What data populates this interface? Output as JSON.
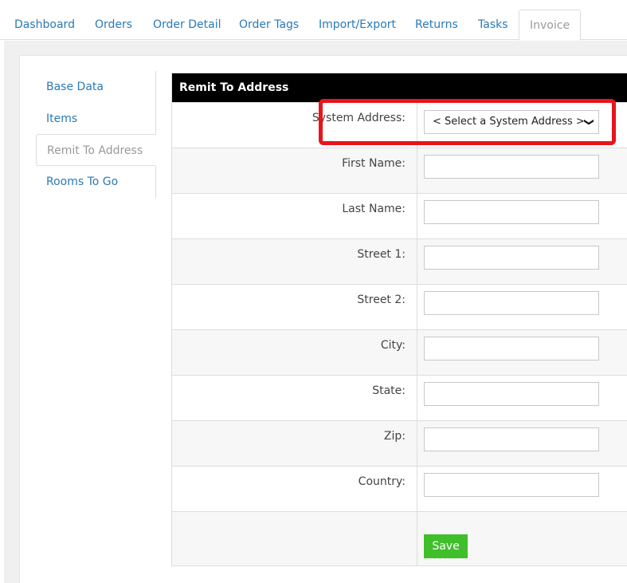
{
  "top_tabs": [
    {
      "label": "Dashboard"
    },
    {
      "label": "Orders"
    },
    {
      "label": "Order Detail"
    },
    {
      "label": "Order Tags"
    },
    {
      "label": "Import/Export"
    },
    {
      "label": "Returns"
    },
    {
      "label": "Tasks"
    },
    {
      "label": "Invoice",
      "active": true
    }
  ],
  "side_nav": [
    {
      "label": "Base Data"
    },
    {
      "label": "Items"
    },
    {
      "label": "Remit To Address",
      "active": true
    },
    {
      "label": "Rooms To Go"
    }
  ],
  "form": {
    "title": "Remit To Address",
    "system_address_label": "System Address:",
    "system_address_selected": "< Select a System Address >",
    "fields": [
      {
        "label": "First Name:",
        "value": ""
      },
      {
        "label": "Last Name:",
        "value": ""
      },
      {
        "label": "Street 1:",
        "value": ""
      },
      {
        "label": "Street 2:",
        "value": ""
      },
      {
        "label": "City:",
        "value": ""
      },
      {
        "label": "State:",
        "value": ""
      },
      {
        "label": "Zip:",
        "value": ""
      },
      {
        "label": "Country:",
        "value": ""
      }
    ],
    "save_label": "Save"
  },
  "colors": {
    "link": "#2a7ab8",
    "header_bg": "#000000",
    "save_button": "#3fbf2a",
    "highlight": "#e8141b"
  }
}
